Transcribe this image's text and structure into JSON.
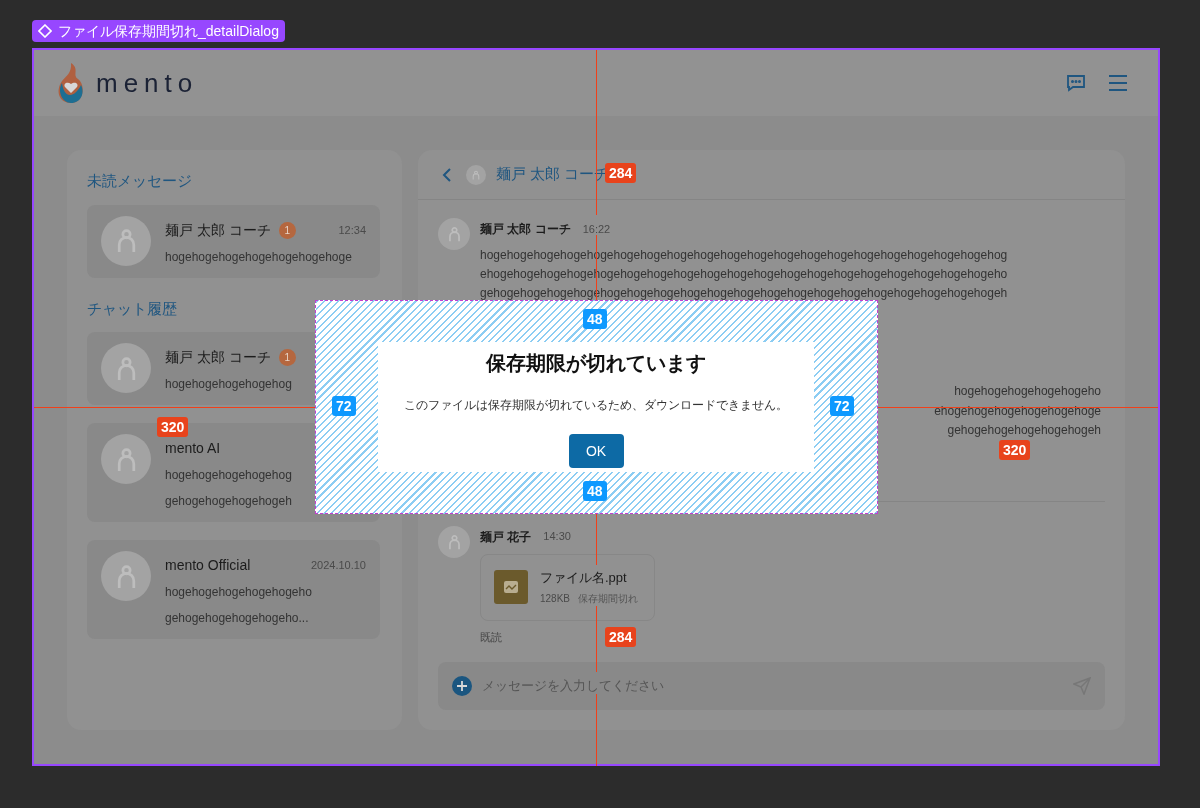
{
  "frame_label": "ファイル保存期間切れ_detailDialog",
  "header": {
    "logo_text": "mento"
  },
  "sidebar": {
    "sections": [
      {
        "title": "未読メッセージ",
        "items": [
          {
            "name": "麺戸 太郎 コーチ",
            "badge": "1",
            "time": "12:34",
            "preview": [
              "hogehogehogehogehogehogehoge"
            ]
          }
        ]
      },
      {
        "title": "チャット履歴",
        "items": [
          {
            "name": "麺戸 太郎 コーチ",
            "badge": "1",
            "preview": [
              "hogehogehogehogehog"
            ]
          },
          {
            "name": "mento AI",
            "preview": [
              "hogehogehogehogehog",
              "gehogehogehogehogeh"
            ]
          },
          {
            "name": "mento Official",
            "time": "2024.10.10",
            "preview": [
              "hogehogehogehogehogeho",
              "gehogehogehogehogeho..."
            ]
          }
        ]
      }
    ]
  },
  "chat": {
    "title": "麺戸 太郎 コーチ",
    "messages": [
      {
        "kind": "text",
        "sender": "麺戸 太郎 コーチ",
        "time": "16:22",
        "lines": [
          "hogehogehogehogehogehogehogehogehogehogehogehogehogehogehogehogehogehogehogehog",
          "ehogehogehogehogehogehogehogehogehogehogehogehogehogehogehogehogehogehogehogeho",
          "gehogehogehogehogehogehogehogehogehogehogehogehogehogehogehogehogehogehogehogeh"
        ]
      },
      {
        "kind": "fragment",
        "lines": [
          "hogehogehogehogehogeho",
          "ehogehogehogehogehogehoge",
          "gehogehogehogehogehogeh"
        ]
      },
      {
        "kind": "file",
        "sender": "麺戸 花子",
        "time": "14:30",
        "file_name": "ファイル名.ppt",
        "size": "128KB",
        "status": "保存期間切れ",
        "read": "既読"
      }
    ]
  },
  "composer": {
    "placeholder": "メッセージを入力してください"
  },
  "dialog": {
    "title": "保存期限が切れています",
    "message": "このファイルは保存期限が切れているため、ダウンロードできません。",
    "button": "OK"
  },
  "measurements": {
    "distances": [
      "284",
      "284",
      "320",
      "320"
    ],
    "paddings": [
      "48",
      "48",
      "72",
      "72"
    ]
  }
}
